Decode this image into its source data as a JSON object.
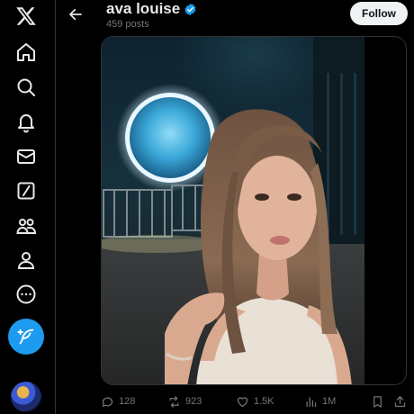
{
  "app": {
    "logo": "x-logo"
  },
  "sidebar": {
    "items": [
      {
        "name": "home",
        "icon": "home-icon"
      },
      {
        "name": "explore",
        "icon": "search-icon"
      },
      {
        "name": "notifications",
        "icon": "bell-icon"
      },
      {
        "name": "messages",
        "icon": "mail-icon"
      },
      {
        "name": "grok",
        "icon": "slash-square-icon"
      },
      {
        "name": "communities",
        "icon": "people-icon"
      },
      {
        "name": "profile",
        "icon": "person-icon"
      },
      {
        "name": "more",
        "icon": "more-circle-icon"
      }
    ],
    "compose_icon": "feather-plus-icon"
  },
  "header": {
    "display_name": "ava louise",
    "verified": true,
    "post_count": "459 posts",
    "follow_label": "Follow"
  },
  "actions": {
    "replies": "128",
    "reposts": "923",
    "likes": "1.5K",
    "views": "1M"
  },
  "colors": {
    "background": "#000000",
    "accent": "#1d9bf0",
    "muted": "#71767b",
    "text": "#e7e9ea",
    "repost_green": "#00ba7c"
  }
}
